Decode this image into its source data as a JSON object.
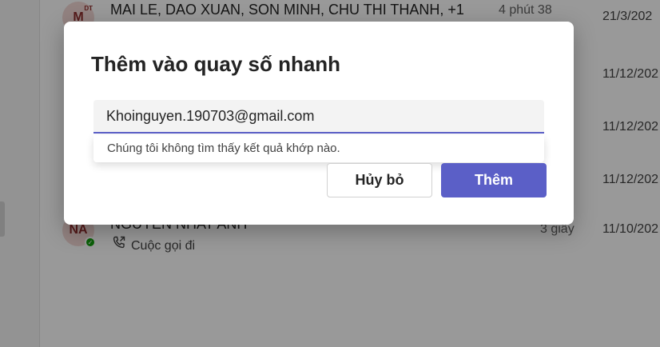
{
  "dialog": {
    "title": "Thêm vào quay số nhanh",
    "input_value": "Khoinguyen.190703@gmail.com",
    "no_results": "Chúng tôi không tìm thấy kết quả khớp nào.",
    "cancel_label": "Hủy bỏ",
    "add_label": "Thêm"
  },
  "calls": [
    {
      "initials": "M",
      "badge": "DT",
      "name": "MAI LE, DAO XUAN, SON MINH, CHU THI THANH, +1",
      "subtitle": "",
      "duration": "4 phút 38",
      "date": "21/3/202"
    },
    {
      "initials": "",
      "badge": "",
      "name": "",
      "subtitle": "",
      "duration": "",
      "date": "11/12/202"
    },
    {
      "initials": "",
      "badge": "",
      "name": "",
      "subtitle": "",
      "duration": "",
      "date": "11/12/202"
    },
    {
      "initials": "",
      "badge": "",
      "name": "",
      "subtitle": "",
      "duration": "",
      "date": "11/12/202"
    },
    {
      "initials": "NA",
      "badge": "",
      "name": "NGUYEN NHAT ANH",
      "subtitle": "Cuộc gọi đi",
      "duration": "3 giây",
      "date": "11/10/202"
    }
  ],
  "colors": {
    "accent": "#5b5fc7",
    "presence": "#13a10e"
  }
}
